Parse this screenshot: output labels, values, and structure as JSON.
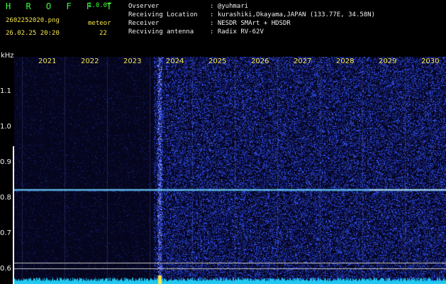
{
  "header": {
    "brand": "H R O F F T",
    "version": "1.0.0f",
    "filename": "2602252020.png",
    "datetime": "26.02.25 20:20",
    "event_label": "meteor",
    "event_count": "22",
    "info": [
      {
        "label": "Ovserver",
        "value": ": @yuhmari"
      },
      {
        "label": "Receiving Location",
        "value": ": kurashiki,Okayama,JAPAN (133.77E, 34.58N)"
      },
      {
        "label": "Receiver",
        "value": ": NESDR SMArt + HDSDR"
      },
      {
        "label": "Recviving antenna",
        "value": ": Radix RV-62V"
      }
    ]
  },
  "chart_data": {
    "type": "heatmap",
    "ylabel": "kHz",
    "y_ticks": [
      "1.1",
      "1.0",
      "0.9",
      "0.8",
      "0.7",
      "0.6"
    ],
    "x_ticks": [
      "2021",
      "2022",
      "2023",
      "2024",
      "2025",
      "2026",
      "2027",
      "2028",
      "2029",
      "2030"
    ],
    "signal_line_khz": 0.825,
    "colors": {
      "background": "#05051e",
      "noise": "#2a35d0",
      "signal": "#6fd8ff",
      "trace": "#22c8f0"
    }
  }
}
